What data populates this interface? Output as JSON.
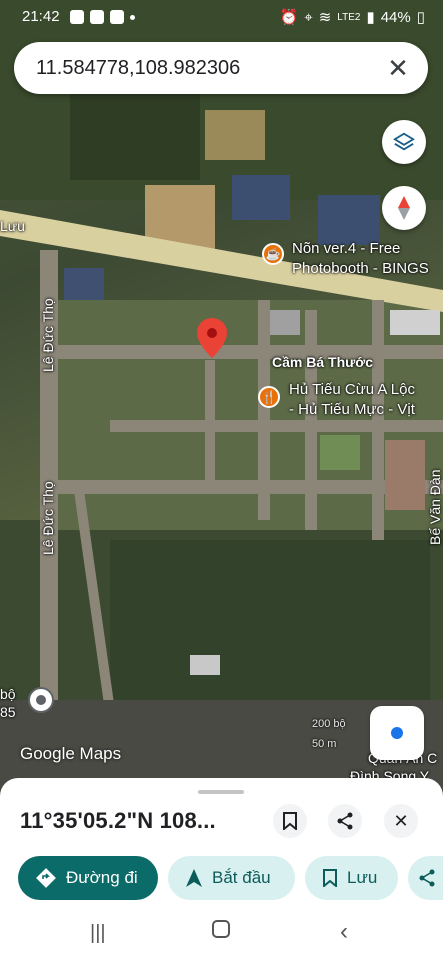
{
  "status_bar": {
    "time": "21:42",
    "battery": "44%",
    "network": "LTE2",
    "carrier": "VoLTE"
  },
  "search": {
    "query": "11.584778,108.982306",
    "close_glyph": "✕"
  },
  "map": {
    "labels": {
      "road_top": "Lưu",
      "street_le_duc_tho_upper": "Lê Đức Thọ",
      "street_le_duc_tho_lower": "Lê Đức Thọ",
      "street_cam_ba_thuoc": "Cầm Bá Thước",
      "street_be_van_dan": "Bế Văn Đàn",
      "poi_photobooth_1": "Nõn ver.4 - Free",
      "poi_photobooth_2": "Photobooth - BINGS",
      "poi_hu_tieu_1": "Hủ Tiếu Cừu A Lộc",
      "poi_hu_tieu_2": "- Hủ Tiếu Mực - Vịt",
      "poi_quan_an_1": "Quán Ăn C",
      "poi_quan_an_2": "Đình Song Y",
      "scale": "200 bộ",
      "scale_m": "50 m",
      "left_fragment_1": "bộ",
      "left_fragment_2": "85"
    },
    "watermark": "Google Maps",
    "icons": [
      "layers-icon",
      "compass-icon",
      "my-location-icon",
      "street-view-icon",
      "map-pin-icon"
    ]
  },
  "sheet": {
    "coords": "11°35'05.2\"N 108...",
    "actions": {
      "directions": "Đường đi",
      "start": "Bắt đầu",
      "save": "Lưu"
    }
  },
  "colors": {
    "primary": "#0b6b68",
    "secondary_chip": "#d8f0f0",
    "pin": "#ea4335"
  }
}
